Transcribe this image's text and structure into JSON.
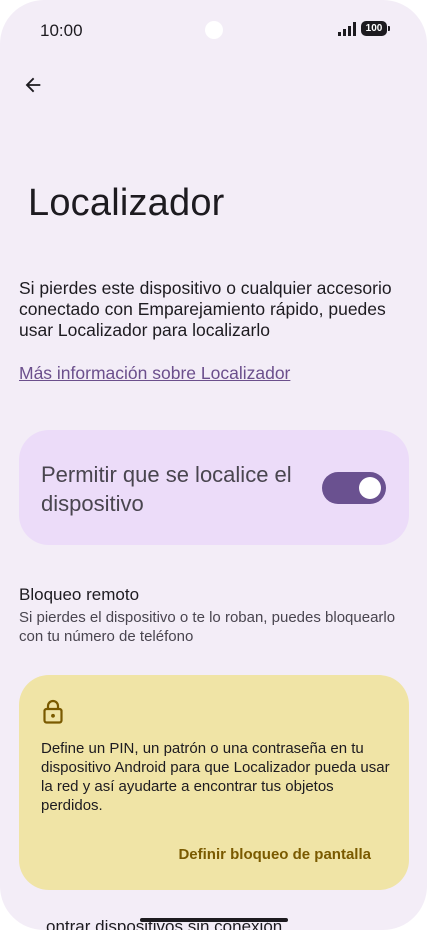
{
  "status_bar": {
    "time": "10:00",
    "battery": "100"
  },
  "header": {
    "title": "Localizador"
  },
  "main": {
    "description": "Si pierdes este dispositivo o cualquier accesorio conectado con Emparejamiento rápido, puedes usar Localizador para localizarlo",
    "learn_more_link": "Más información sobre Localizador",
    "toggle_card": {
      "label": "Permitir que se localice el dispositivo",
      "enabled": true
    },
    "remote_lock": {
      "title": "Bloqueo remoto",
      "summary": "Si pierdes el dispositivo o te lo roban, puedes bloquearlo con tu número de teléfono"
    },
    "warning_card": {
      "icon": "lock-icon",
      "text": "Define un PIN, un patrón o una contraseña en tu dispositivo Android para que Localizador pueda usar la red y así ayudarte a encontrar tus objetos perdidos.",
      "action_label": "Definir bloqueo de pantalla"
    },
    "partial_item": "ontrar dispositivos sin conexión"
  },
  "colors": {
    "background": "#f3edf7",
    "toggle_card_bg": "#ecdcf9",
    "toggle_on": "#6a5190",
    "warning_card_bg": "#f0e4a6",
    "link": "#6b4f8c",
    "action": "#7a5a00"
  }
}
